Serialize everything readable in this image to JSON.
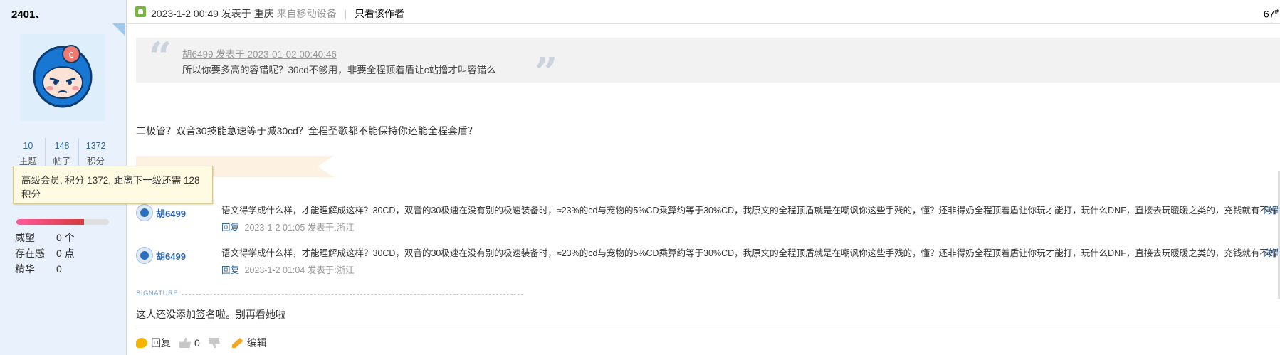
{
  "sidebar": {
    "username": "2401、",
    "stats": [
      {
        "num": "10",
        "label": "主题"
      },
      {
        "num": "148",
        "label": "帖子"
      },
      {
        "num": "1372",
        "label": "积分"
      }
    ],
    "tooltip": "高级会员, 积分 1372, 距离下一级还需 128 积分",
    "progress_percent": 73,
    "extras": [
      {
        "key": "威望",
        "value": "0 个"
      },
      {
        "key": "存在感",
        "value": "0 点"
      },
      {
        "key": "精华",
        "value": "0"
      }
    ]
  },
  "header": {
    "datetime": "2023-1-2 00:49",
    "posted_in": "发表于",
    "location": "重庆",
    "device": "来自移动设备",
    "only_author": "只看该作者",
    "floor": "67",
    "floor_mark": "#"
  },
  "quote": {
    "author_line": "胡6499 发表于 2023-01-02 00:40:46",
    "text": "所以你要多高的容错呢？30cd不够用，非要全程顶着盾让c站撸才叫容错么"
  },
  "body": {
    "text": "二极管？双音30技能急速等于减30cd？全程圣歌都不能保持你还能全程套盾？"
  },
  "replies": [
    {
      "name": "胡6499",
      "text": "语文得学成什么样，才能理解成这样？30CD，双音的30极速在没有别的极速装备时，≈23%的cd与宠物的5%CD乘算约等于30%CD，我原文的全程顶盾就是在嘲讽你这些手残的，懂？还非得奶全程顶着盾让你玩才能打，玩什么DNF，直接去玩暖暖之类的，充钱就有不好么？",
      "more": "详情",
      "reply_label": "回复",
      "meta": "2023-1-2 01:05 发表于:浙江"
    },
    {
      "name": "胡6499",
      "text": "语文得学成什么样，才能理解成这样？30CD，双音的30极速在没有别的极速装备时，≈23%的cd与宠物的5%CD乘算约等于30%CD，我原文的全程顶盾就是在嘲讽你这些手残的，懂？还非得奶全程顶着盾让你玩才能打，玩什么DNF，直接去玩暖暖之类的，充钱就有不好么？",
      "more": "详情",
      "reply_label": "回复",
      "meta": "2023-1-2 01:04 发表于:浙江"
    }
  ],
  "signature": {
    "label": "SIGNATURE",
    "text": "这人还没添加签名啦。别再看她啦"
  },
  "footer": {
    "reply": "回复",
    "up_count": "0",
    "edit": "编辑"
  }
}
